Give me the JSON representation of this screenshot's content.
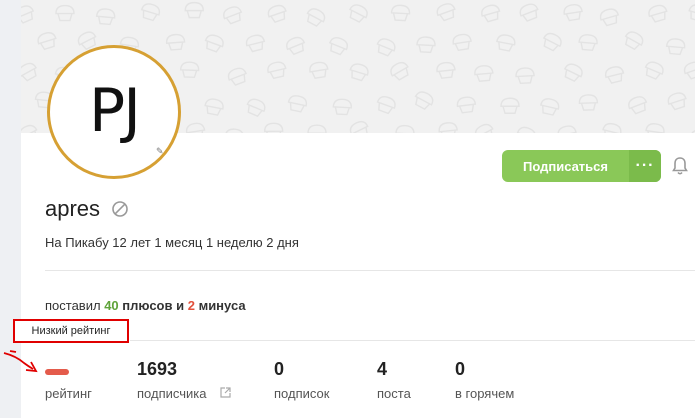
{
  "profile": {
    "avatar_text": "PJ",
    "username": "apres",
    "tenure": "На Пикабу 12 лет 1 месяц 1 неделю 2 дня",
    "subscribe_label": "Подписаться",
    "more_label": "···"
  },
  "votes": {
    "prefix": "поставил",
    "plus_count": "40",
    "mid": "плюсов и",
    "minus_count": "2",
    "suffix": "минуса"
  },
  "tooltip": "Низкий рейтинг",
  "stats": [
    {
      "value": "",
      "label": "рейтинг"
    },
    {
      "value": "1693",
      "label": "подписчика"
    },
    {
      "value": "0",
      "label": "подписок"
    },
    {
      "value": "4",
      "label": "поста"
    },
    {
      "value": "0",
      "label": "в горячем"
    }
  ],
  "colors": {
    "accent_green": "#8ac858",
    "avatar_border": "#d6a033",
    "negative_red": "#e45b4b",
    "annotation_red": "#e00000"
  },
  "icons": [
    "verified-icon",
    "bell-icon",
    "external-link-icon",
    "more-icon"
  ]
}
